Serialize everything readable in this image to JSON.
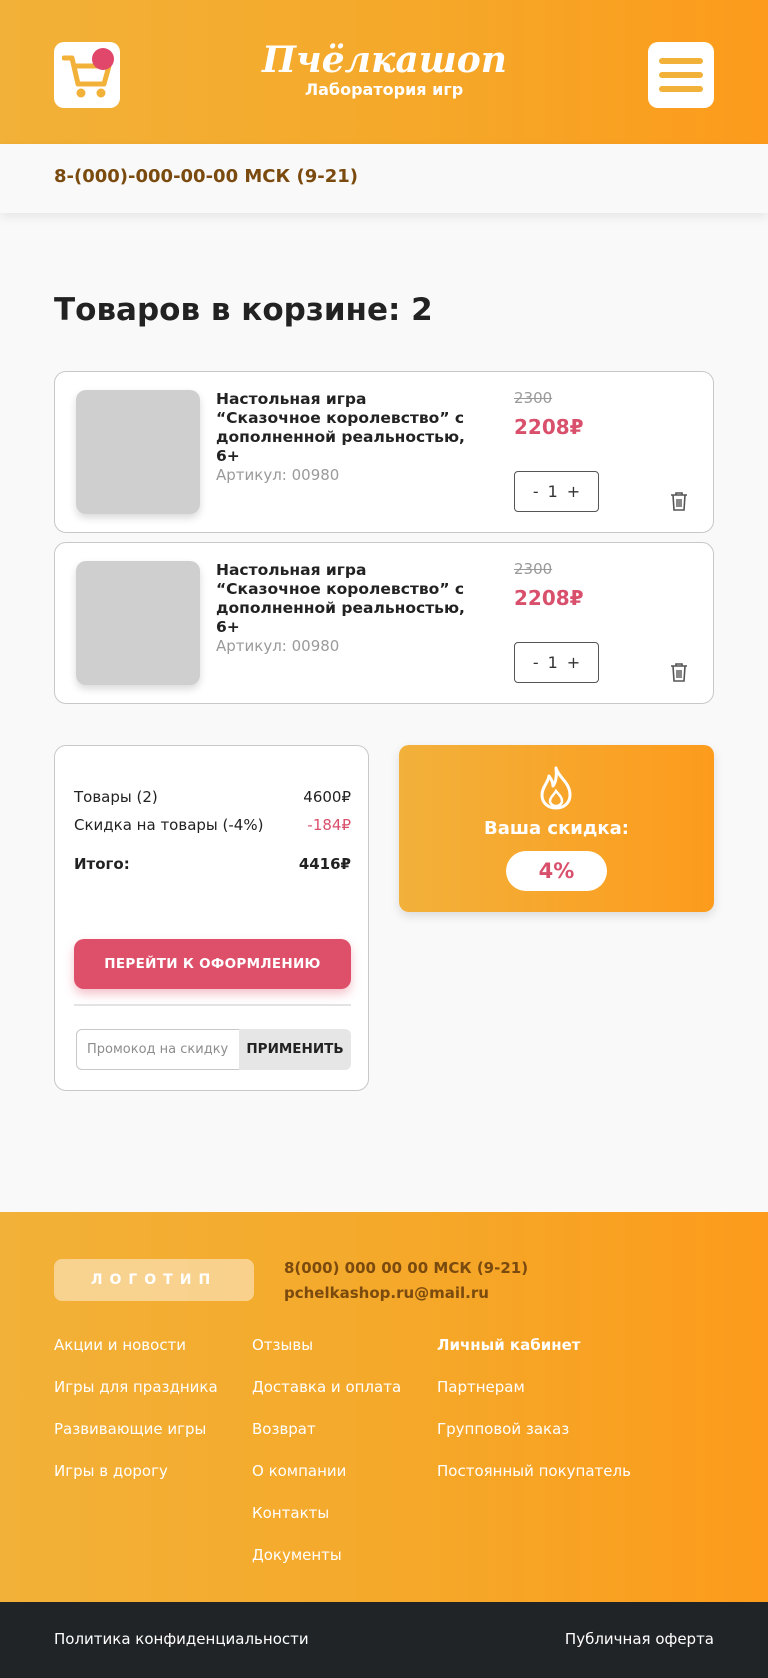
{
  "header": {
    "logo_main": "Пчёлкашоп",
    "logo_sub": "Лаборатория игр",
    "phone": "8-(000)-000-00-00 МСК (9-21)"
  },
  "cart": {
    "title": "Товаров в корзине: 2",
    "items": [
      {
        "name": "Настольная игра “Сказочное королевство” с дополненной реальностью, 6+",
        "sku": "Артикул: 00980",
        "old_price": "2300",
        "price": "2208₽",
        "qty_minus": "-",
        "qty": "1",
        "qty_plus": "+"
      },
      {
        "name": "Настольная игра “Сказочное королевство” с дополненной реальностью, 6+",
        "sku": "Артикул: 00980",
        "old_price": "2300",
        "price": "2208₽",
        "qty_minus": "-",
        "qty": "1",
        "qty_plus": "+"
      }
    ]
  },
  "summary": {
    "goods_label": "Товары (2)",
    "goods_value": "4600₽",
    "discount_label": "Скидка на товары (-4%)",
    "discount_value": "-184₽",
    "total_label": "Итого:",
    "total_value": "4416₽",
    "checkout_label": "ПЕРЕЙТИ К ОФОРМЛЕНИЮ",
    "promo_placeholder": "Промокод на скидку",
    "promo_button": "ПРИМЕНИТЬ"
  },
  "discount_card": {
    "label": "Ваша скидка:",
    "value": "4%"
  },
  "footer": {
    "logo_text": "ЛОГОТИП",
    "phone": "8(000) 000 00 00 МСК (9-21)",
    "email": "pchelkashop.ru@mail.ru",
    "col1": [
      "Акции и новости",
      "Игры для праздника",
      "Развивающие игры",
      "Игры в дорогу"
    ],
    "col2": [
      "Отзывы",
      "Доставка и оплата",
      "Возврат",
      "О компании",
      "Контакты",
      "Документы"
    ],
    "col3": [
      "Личный кабинет",
      "Партнерам",
      "Групповой заказ",
      "Постоянный покупатель"
    ]
  },
  "bottom": {
    "privacy": "Политика конфиденциальности",
    "offer": "Публичная оферта"
  },
  "colors": {
    "accent_orange": "#f5a829",
    "accent_pink": "#de4f69",
    "brown_text": "#7a4a0e",
    "dark_bar": "#212427"
  }
}
